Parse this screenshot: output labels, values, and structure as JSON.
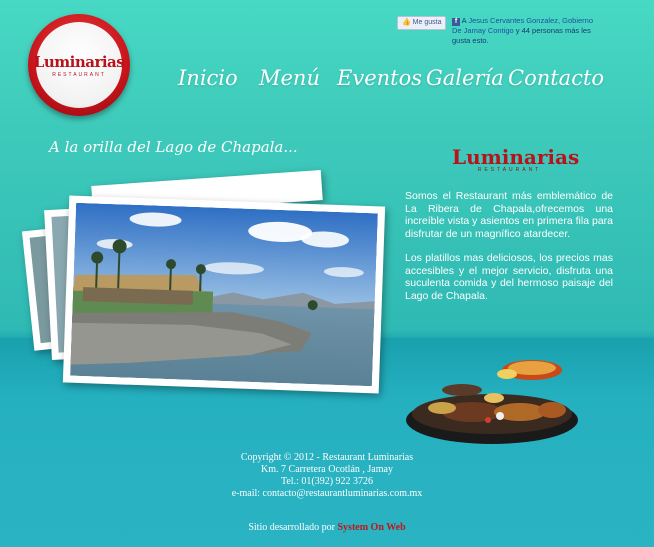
{
  "logo": {
    "name": "Luminarias",
    "sub": "RESTAURANT"
  },
  "facebook": {
    "like_label": "Me gusta",
    "text_prefix": "A",
    "friends": "Jesus Cervantes Gonzalez, Gobierno De Jamay Contigo",
    "text_suffix": "y 44 personas más les gusta esto."
  },
  "nav": {
    "items": [
      "Inicio",
      "Menú",
      "Eventos",
      "Galería",
      "Contacto"
    ]
  },
  "tagline": "A la orilla del Lago de Chapala...",
  "brand": {
    "name": "Luminarias",
    "sub": "RESTAURANT"
  },
  "description": {
    "p1": "Somos el Restaurant más emblemático de La Ribera de Chapala,ofrecemos una increíble vista y asientos en primera fila para disfrutar de un magnífico atardecer.",
    "p2": "Los platillos mas deliciosos, los precios mas accesibles y el mejor servicio, disfruta una suculenta comida y del hermoso paisaje del Lago de Chapala."
  },
  "footer": {
    "copyright": "Copyright © 2012 - Restaurant Luminarias",
    "address": "Km. 7 Carretera Ocotlán , Jamay",
    "phone": "Tel.: 01(392) 922 3726",
    "email": "e-mail: contacto@restaurantluminarias.com.mx",
    "credit_prefix": "Sitio desarrollado por",
    "credit_link": "System On Web"
  },
  "colors": {
    "brand_red": "#b8121b",
    "background": "#3fcbbb",
    "link_red": "#c0151b"
  },
  "icons": {
    "facebook": "facebook-icon"
  }
}
